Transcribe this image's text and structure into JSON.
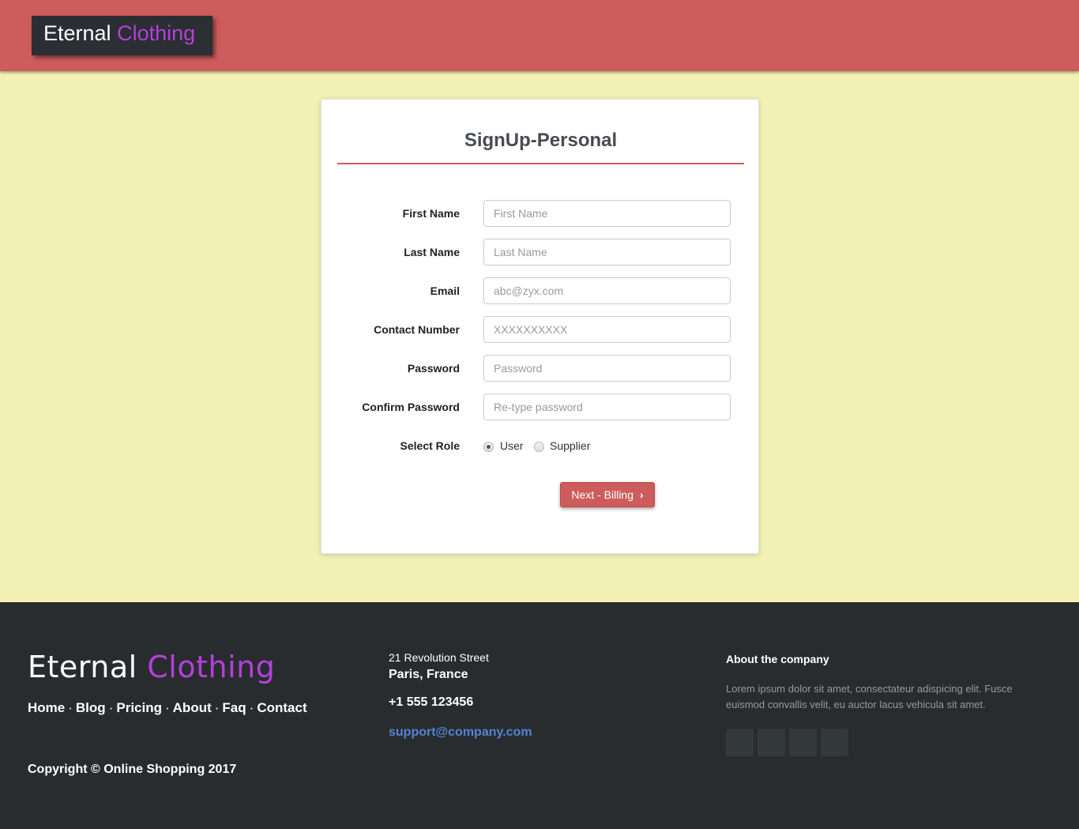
{
  "header": {
    "brand_part1": "Eternal",
    "brand_part2": "Clothing"
  },
  "form": {
    "title": "SignUp-Personal",
    "fields": [
      {
        "label": "First Name",
        "placeholder": "First Name"
      },
      {
        "label": "Last Name",
        "placeholder": "Last Name"
      },
      {
        "label": "Email",
        "placeholder": "abc@zyx.com"
      },
      {
        "label": "Contact Number",
        "placeholder": "XXXXXXXXXX"
      },
      {
        "label": "Password",
        "placeholder": "Password"
      },
      {
        "label": "Confirm Password",
        "placeholder": "Re-type password"
      }
    ],
    "role": {
      "label": "Select Role",
      "options": [
        "User",
        "Supplier"
      ],
      "selected": "User"
    },
    "next_button": "Next - Billing",
    "next_icon": "chevron-right-icon"
  },
  "footer": {
    "brand_part1": "Eternal",
    "brand_part2": "Clothing",
    "links": [
      "Home",
      "Blog",
      "Pricing",
      "About",
      "Faq",
      "Contact"
    ],
    "link_separator": "·",
    "copyright": "Copyright © Online Shopping 2017",
    "street": "21 Revolution Street",
    "city": "Paris, France",
    "phone": "+1 555 123456",
    "email": "support@company.com",
    "about_heading": "About the company",
    "about_text": "Lorem ipsum dolor sit amet, consectateur adispicing elit. Fusce euismod convallis velit, eu auctor lacus vehicula sit amet."
  },
  "colors": {
    "header_bg": "#cd5c5c",
    "page_bg": "#f2f0b4",
    "brand_box": "#2b2e33",
    "brand_accent": "#b340d8",
    "footer_bg": "#292c2f",
    "link_blue": "#5383d3"
  }
}
